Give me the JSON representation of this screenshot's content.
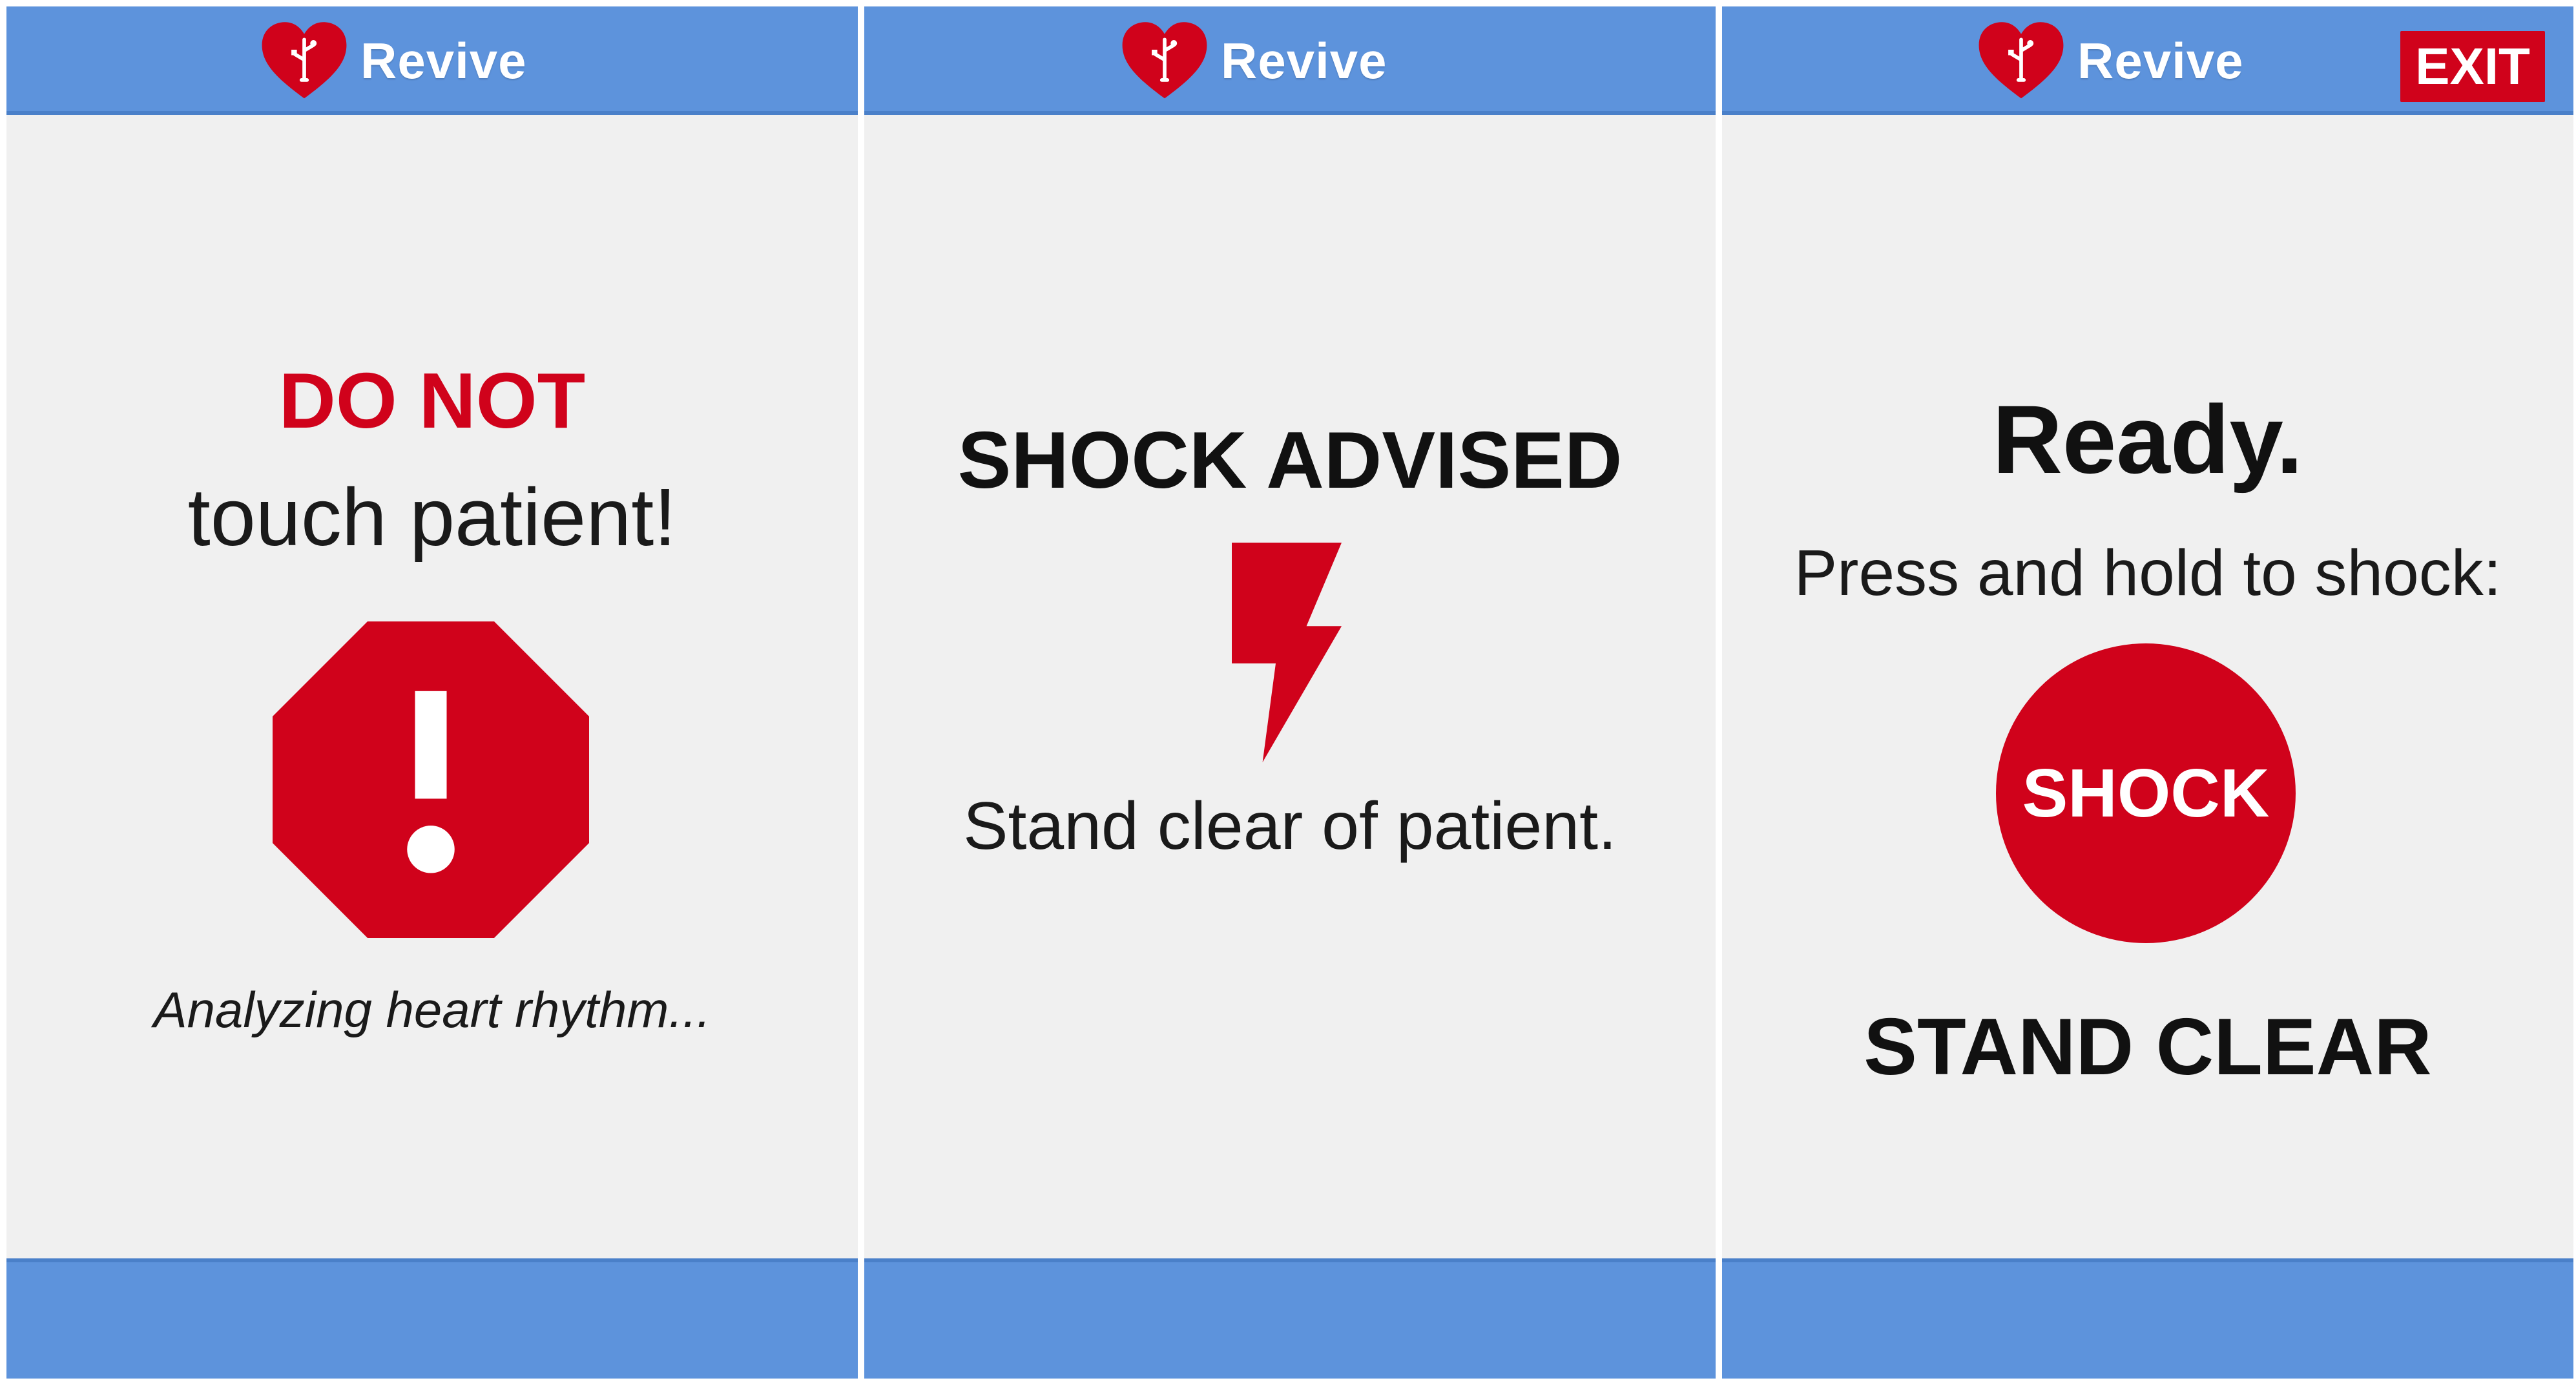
{
  "colors": {
    "bar_blue": "#5d93dc",
    "alert_red": "#d0021b",
    "screen_bg": "#f0f0f0",
    "text_dark": "#111111"
  },
  "screens": [
    {
      "header": {
        "app_name": "Revive",
        "logo_icon": "heart-plug-icon"
      },
      "warning": "DO NOT",
      "instruction": "touch patient!",
      "icon": "stop-exclamation-icon",
      "status": "Analyzing heart rhythm..."
    },
    {
      "header": {
        "app_name": "Revive",
        "logo_icon": "heart-plug-icon"
      },
      "title": "SHOCK ADVISED",
      "icon": "lightning-bolt-icon",
      "instruction": "Stand clear of patient."
    },
    {
      "header": {
        "app_name": "Revive",
        "logo_icon": "heart-plug-icon",
        "exit_label": "EXIT"
      },
      "title": "Ready.",
      "instruction": "Press and hold to shock:",
      "shock_label": "SHOCK",
      "warning": "STAND CLEAR"
    }
  ]
}
